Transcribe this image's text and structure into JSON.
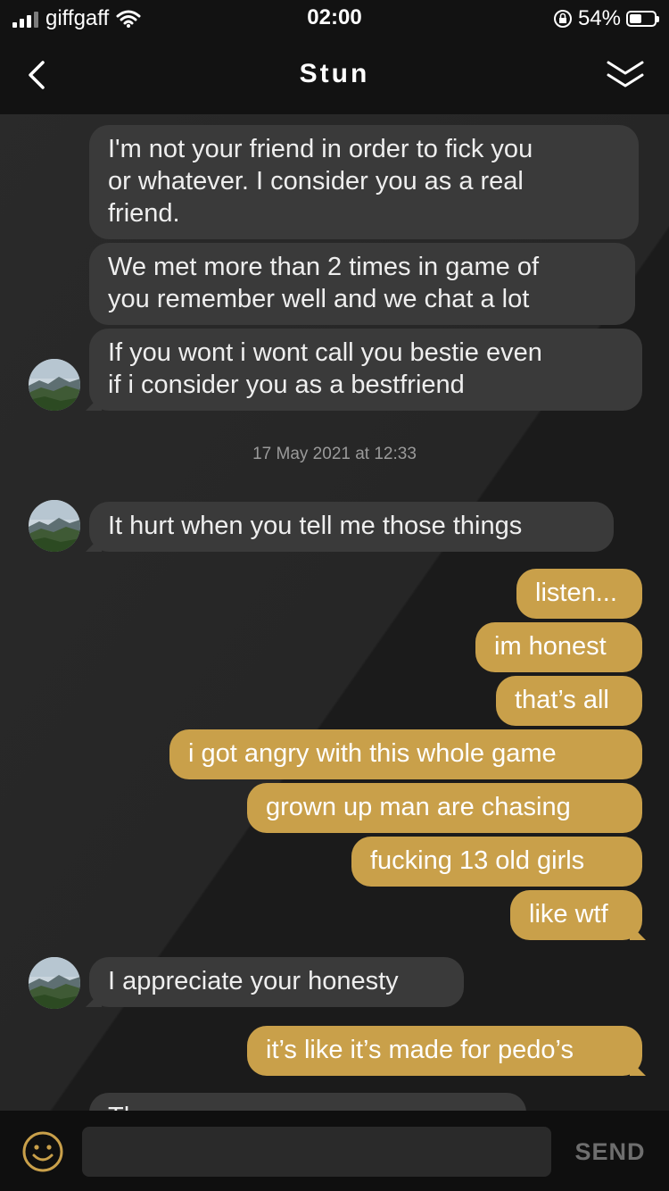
{
  "status_bar": {
    "carrier": "giffgaff",
    "time": "02:00",
    "battery": "54%"
  },
  "header": {
    "title": "Stun",
    "back_icon": "chevron-left-icon",
    "collapse_icon": "double-chevron-down-icon"
  },
  "messages": [
    {
      "side": "in",
      "lines": [
        "I'm not your friend in order to fick you",
        "or whatever. I consider you as a real",
        "friend."
      ]
    },
    {
      "side": "in",
      "lines": [
        "We met more than 2 times in game of",
        "you remember well and we chat a lot"
      ]
    },
    {
      "side": "in",
      "lines": [
        "If you wont i wont call you bestie even",
        "if i consider you as a bestfriend"
      ]
    },
    {
      "side": "in",
      "lines": [
        "It hurt when you tell me those things"
      ]
    },
    {
      "side": "out",
      "lines": [
        "listen..."
      ]
    },
    {
      "side": "out",
      "lines": [
        "im honest"
      ]
    },
    {
      "side": "out",
      "lines": [
        "that’s all"
      ]
    },
    {
      "side": "out",
      "lines": [
        "i got angry with this whole game"
      ]
    },
    {
      "side": "out",
      "lines": [
        "grown up man are chasing"
      ]
    },
    {
      "side": "out",
      "lines": [
        "fucking 13 old girls"
      ]
    },
    {
      "side": "out",
      "lines": [
        "like wtf"
      ]
    },
    {
      "side": "in",
      "lines": [
        "I appreciate your honesty"
      ]
    },
    {
      "side": "out",
      "lines": [
        "it’s like it’s made for pedo’s"
      ]
    },
    {
      "side": "in",
      "lines": [
        "Th"
      ]
    }
  ],
  "timestamp": "17 May 2021 at 12:33",
  "input_bar": {
    "emoji_icon": "smiley-icon",
    "placeholder": "",
    "send_label": "SEND"
  },
  "colors": {
    "incoming_bubble": "#3a3a3a",
    "outgoing_bubble": "#c9a04a",
    "background": "#1b1b1b",
    "bar": "#121212"
  }
}
